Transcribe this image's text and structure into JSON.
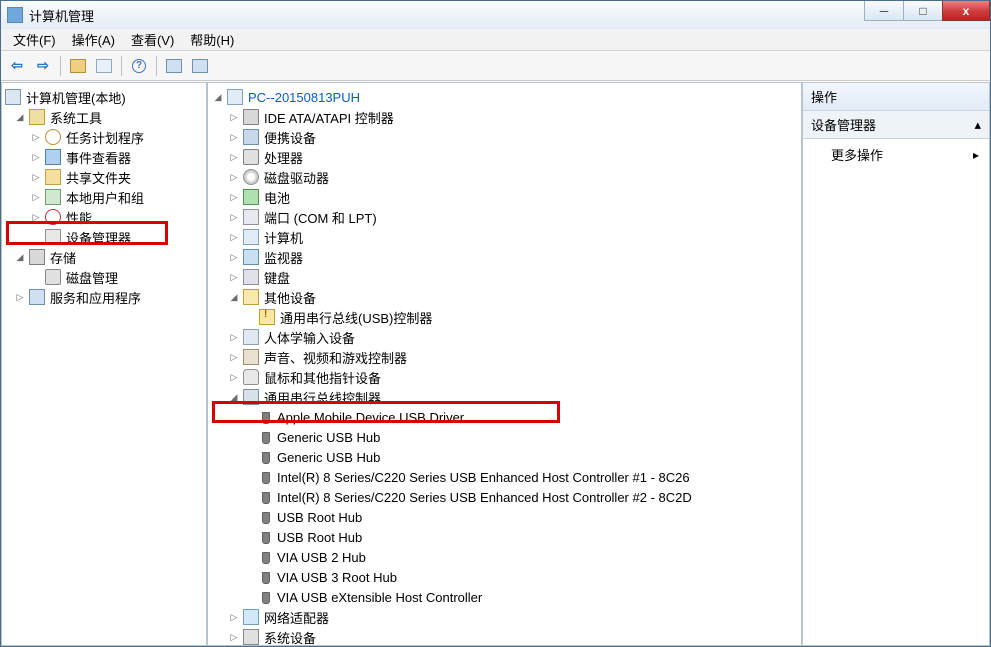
{
  "title": "计算机管理",
  "menu": {
    "file": "文件(F)",
    "action": "操作(A)",
    "view": "查看(V)",
    "help": "帮助(H)"
  },
  "toolbar": {
    "back": "←",
    "fwd": "→"
  },
  "left": {
    "root": "计算机管理(本地)",
    "systools": "系统工具",
    "sched": "任务计划程序",
    "event": "事件查看器",
    "share": "共享文件夹",
    "users": "本地用户和组",
    "perf": "性能",
    "devmgr": "设备管理器",
    "storage": "存储",
    "diskmgmt": "磁盘管理",
    "svcapp": "服务和应用程序"
  },
  "mid": {
    "root": "PC--20150813PUH",
    "ide": "IDE ATA/ATAPI 控制器",
    "portable": "便携设备",
    "cpu": "处理器",
    "cddrv": "磁盘驱动器",
    "batt": "电池",
    "ports": "端口 (COM 和 LPT)",
    "comp": "计算机",
    "monitor": "监视器",
    "keyboard": "键盘",
    "other": "其他设备",
    "other_usb": "通用串行总线(USB)控制器",
    "hid": "人体学输入设备",
    "sound": "声音、视频和游戏控制器",
    "mouse": "鼠标和其他指针设备",
    "usbctrl": "通用串行总线控制器",
    "usb": {
      "apple": "Apple Mobile Device USB Driver",
      "gh1": "Generic USB Hub",
      "gh2": "Generic USB Hub",
      "intel1": "Intel(R) 8 Series/C220 Series USB Enhanced Host Controller #1 - 8C26",
      "intel2": "Intel(R) 8 Series/C220 Series USB Enhanced Host Controller #2 - 8C2D",
      "root1": "USB Root Hub",
      "root2": "USB Root Hub",
      "via2": "VIA USB 2 Hub",
      "via3": "VIA USB 3 Root Hub",
      "viax": "VIA USB eXtensible Host Controller"
    },
    "netadpt": "网络适配器",
    "sysdev": "系统设备"
  },
  "right": {
    "hdr": "操作",
    "devmgr": "设备管理器",
    "more": "更多操作"
  },
  "winbtns": {
    "min": "─",
    "max": "□",
    "close": "x"
  }
}
